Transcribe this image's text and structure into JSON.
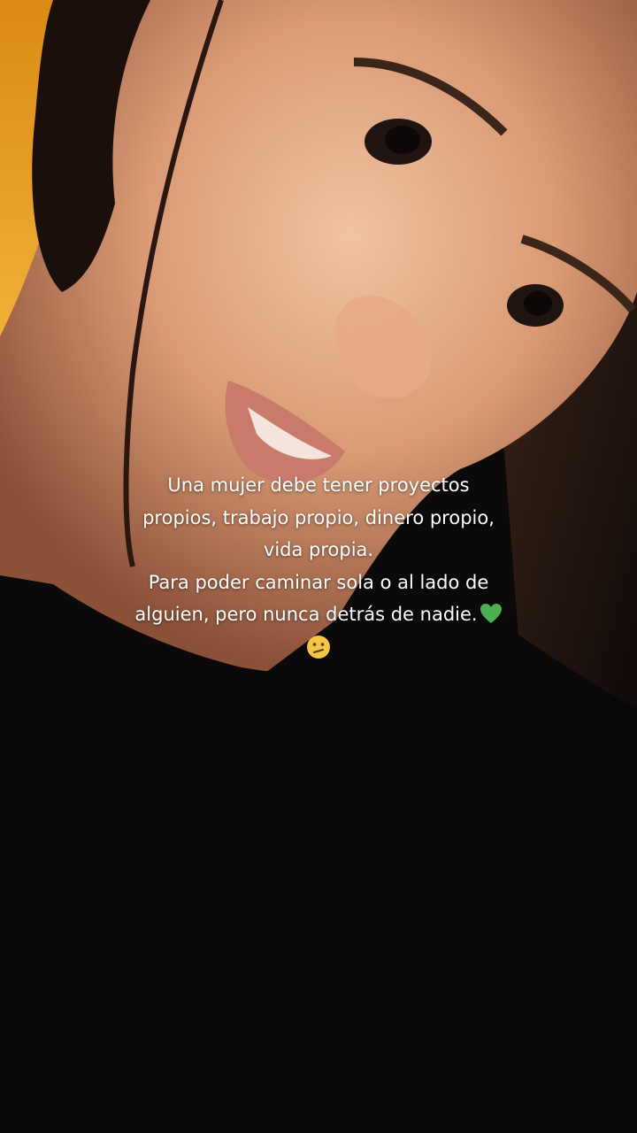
{
  "caption": {
    "lines": [
      "Una mujer debe tener proyectos",
      "propios, trabajo propio, dinero propio,",
      "vida propia.",
      "Para poder caminar sola o al lado de",
      "alguien, pero nunca detrás de nadie."
    ],
    "emojis": [
      "green-heart",
      "face-with-diagonal-mouth"
    ]
  },
  "colors": {
    "text": "#ffffff",
    "heart": "#4caf50",
    "emoji_face": "#f5c543"
  }
}
